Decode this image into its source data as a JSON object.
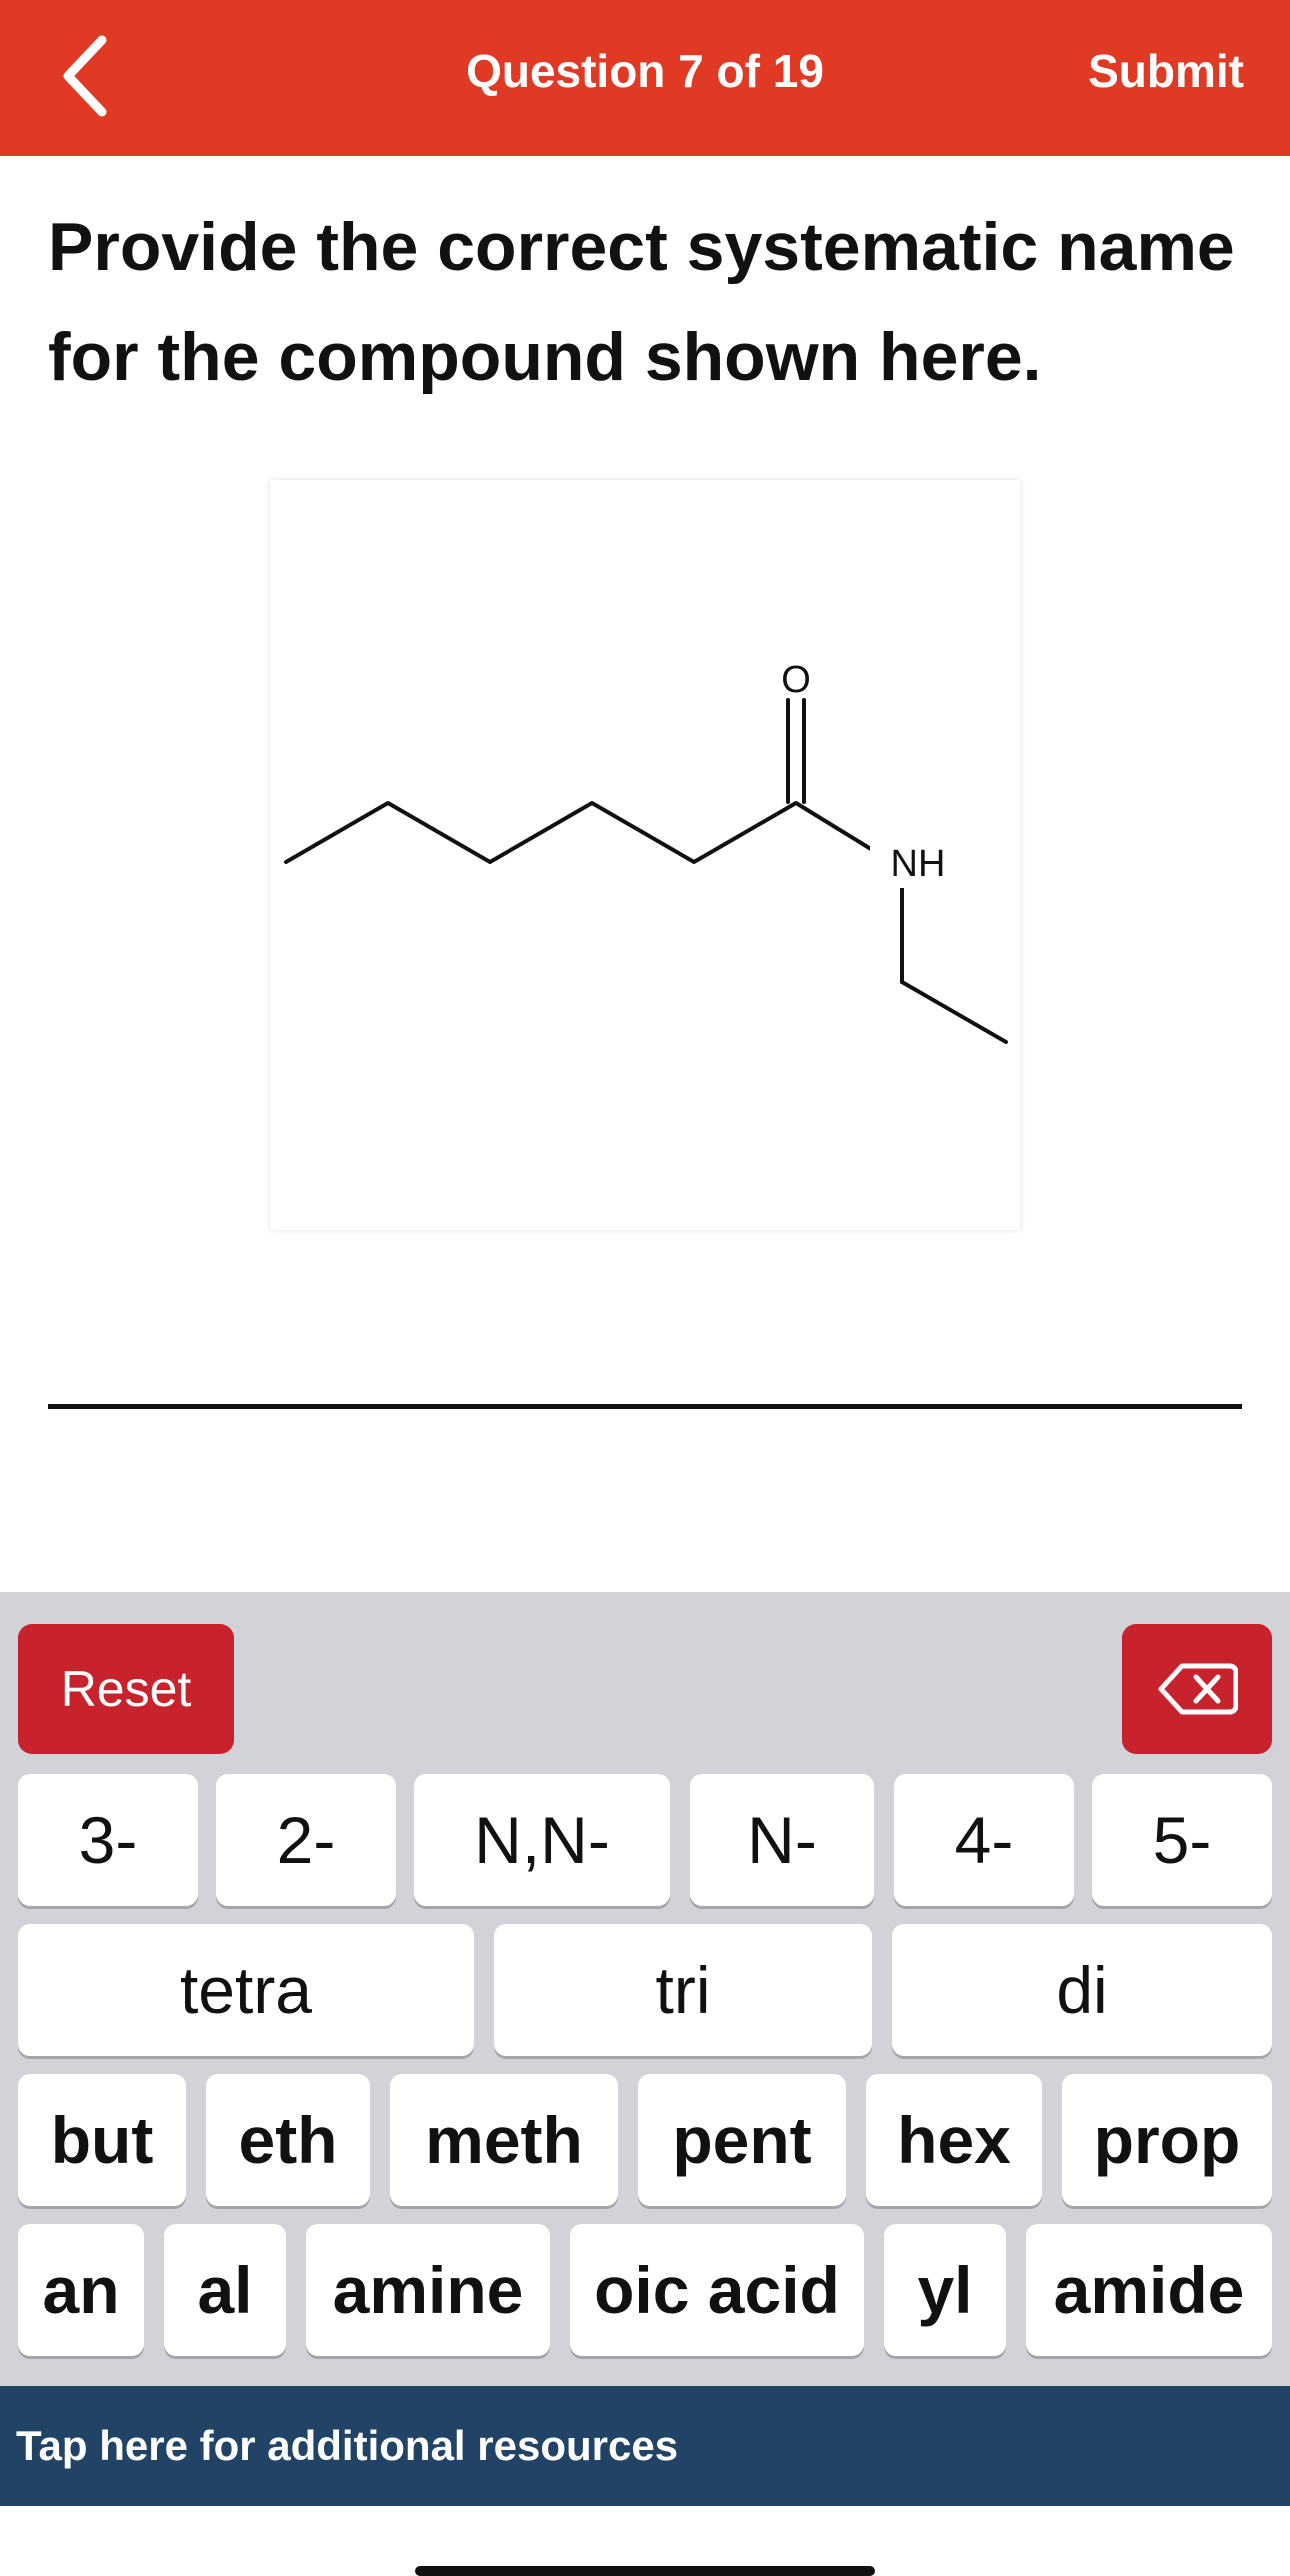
{
  "header": {
    "title": "Question 7 of 19",
    "submit_label": "Submit",
    "color": "#e03a25"
  },
  "question": {
    "text": "Provide the correct systematic name for the compound shown here."
  },
  "structure": {
    "oxygen_label": "O",
    "nitrogen_label": "NH"
  },
  "answer": {
    "value": ""
  },
  "keyboard": {
    "reset_label": "Reset",
    "backspace_icon": "backspace-icon",
    "row1": [
      "3-",
      "2-",
      "N,N-",
      "N-",
      "4-",
      "5-"
    ],
    "row2": [
      "tetra",
      "tri",
      "di"
    ],
    "row3": [
      "but",
      "eth",
      "meth",
      "pent",
      "hex",
      "prop"
    ],
    "row4": [
      "an",
      "al",
      "amine",
      "oic acid",
      "yl",
      "amide"
    ],
    "action_color": "#c8232c"
  },
  "resources": {
    "label": "Tap here for additional resources",
    "color": "#214466"
  }
}
